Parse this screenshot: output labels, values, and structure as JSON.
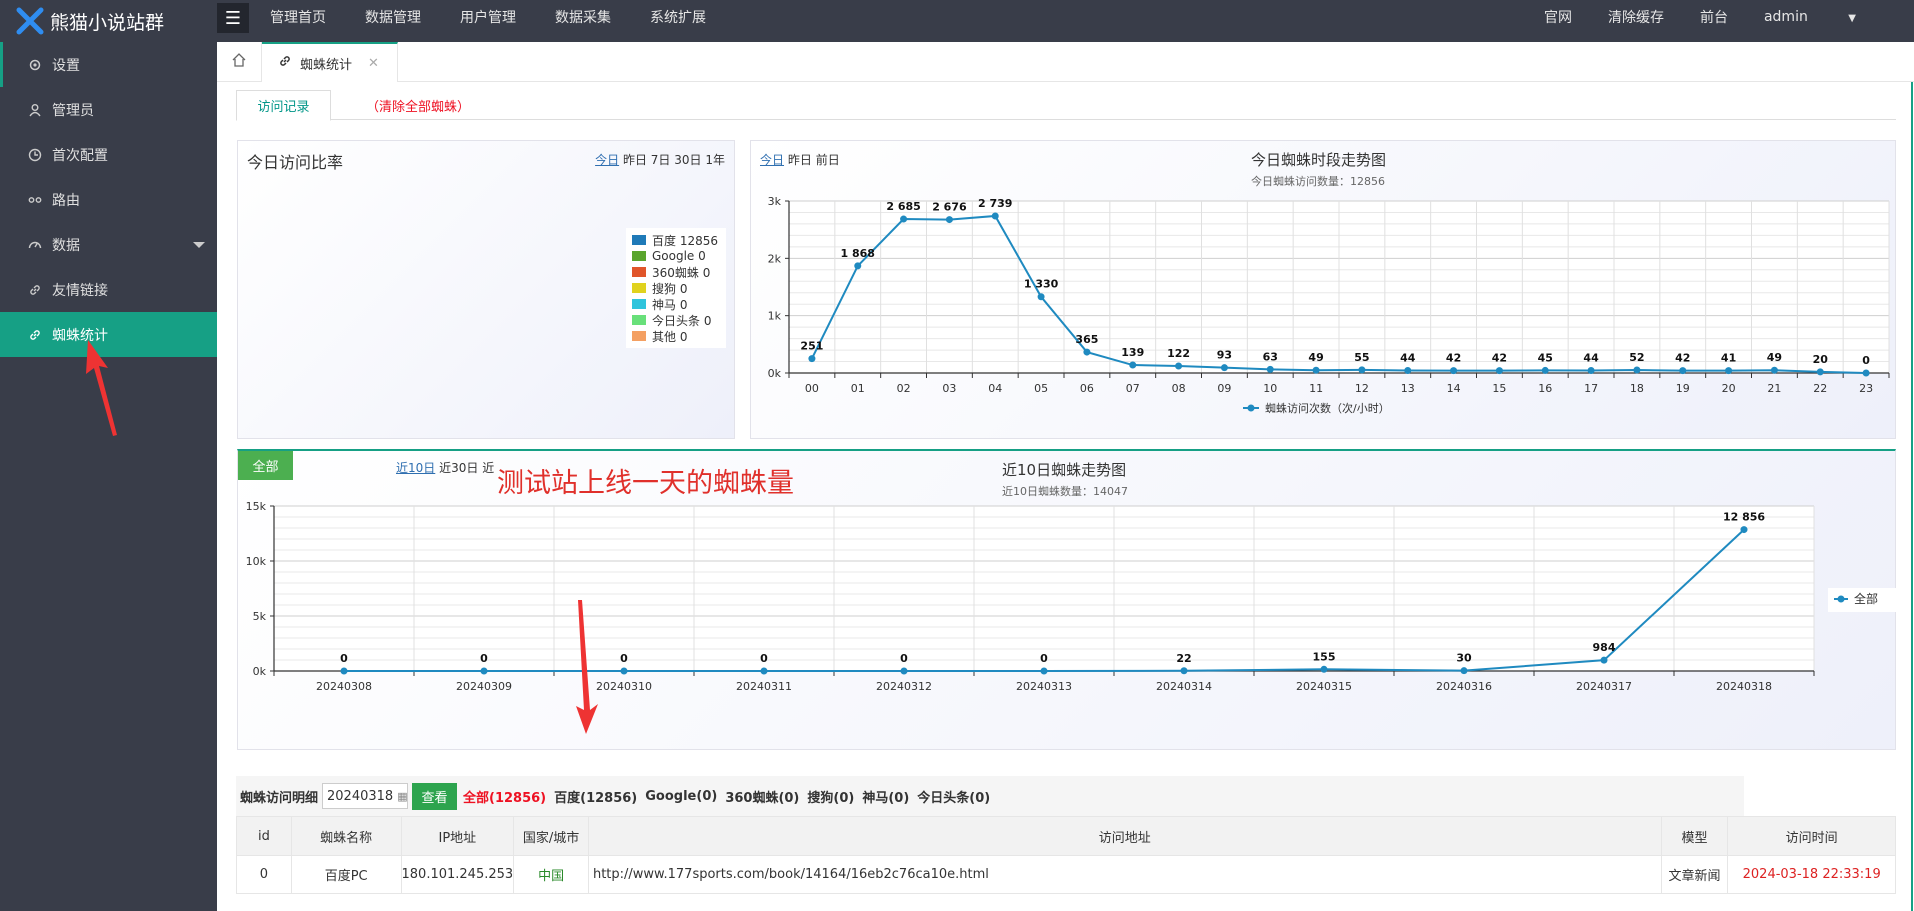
{
  "brand": {
    "name": "熊猫小说站群"
  },
  "topnav": {
    "items": [
      "管理首页",
      "数据管理",
      "用户管理",
      "数据采集",
      "系统扩展"
    ],
    "right": [
      "官网",
      "清除缓存",
      "前台"
    ],
    "user": "admin"
  },
  "sidebar": {
    "items": [
      {
        "label": "设置",
        "icon": "gear-icon"
      },
      {
        "label": "管理员",
        "icon": "user-icon"
      },
      {
        "label": "首次配置",
        "icon": "clock-icon"
      },
      {
        "label": "路由",
        "icon": "route-icon"
      },
      {
        "label": "数据",
        "icon": "dashboard-icon"
      },
      {
        "label": "友情链接",
        "icon": "link-icon"
      },
      {
        "label": "蜘蛛统计",
        "icon": "link-icon"
      }
    ]
  },
  "tabs": {
    "current": "蜘蛛统计"
  },
  "subtabs": {
    "records": "访问记录",
    "clear": "（清除全部蜘蛛）"
  },
  "ratio_panel": {
    "title": "今日访问比率",
    "periods": [
      "今日",
      "昨日",
      "7日",
      "30日",
      "1年"
    ],
    "legend": [
      {
        "label": "百度 12856",
        "color": "#1f7ab8"
      },
      {
        "label": "Google 0",
        "color": "#5aa52d"
      },
      {
        "label": "360蜘蛛 0",
        "color": "#e0552a"
      },
      {
        "label": "搜狗 0",
        "color": "#e0d21e"
      },
      {
        "label": "神马 0",
        "color": "#2fc4dc"
      },
      {
        "label": "今日头条 0",
        "color": "#68e07a"
      },
      {
        "label": "其他 0",
        "color": "#f4a062"
      }
    ]
  },
  "hourly_panel": {
    "periods": [
      "今日",
      "昨日",
      "前日"
    ],
    "title": "今日蜘蛛时段走势图",
    "subtitle": "今日蜘蛛访问数量：12856",
    "legend": "蜘蛛访问次数（次/小时）",
    "chart_data": {
      "type": "line",
      "categories": [
        "00",
        "01",
        "02",
        "03",
        "04",
        "05",
        "06",
        "07",
        "08",
        "09",
        "10",
        "11",
        "12",
        "13",
        "14",
        "15",
        "16",
        "17",
        "18",
        "19",
        "20",
        "21",
        "22",
        "23"
      ],
      "values": [
        251,
        1868,
        2685,
        2676,
        2739,
        1330,
        365,
        139,
        122,
        93,
        63,
        49,
        55,
        44,
        42,
        42,
        45,
        44,
        52,
        42,
        41,
        49,
        20,
        0
      ],
      "labels": [
        "251",
        "1 868",
        "2 685",
        "2 676",
        "2 739",
        "1 330",
        "365",
        "139",
        "122",
        "93",
        "63",
        "49",
        "55",
        "44",
        "42",
        "42",
        "45",
        "44",
        "52",
        "42",
        "41",
        "49",
        "20",
        "0"
      ],
      "yticks": [
        "0k",
        "1k",
        "2k",
        "3k"
      ],
      "ylim": [
        0,
        3000
      ],
      "color": "#1f8ac0"
    }
  },
  "ten_day_panel": {
    "all_label": "全部",
    "periods": [
      "近10日",
      "近30日",
      "近"
    ],
    "note": "测试站上线一天的蜘蛛量",
    "title": "近10日蜘蛛走势图",
    "subtitle": "近10日蜘蛛数量：14047",
    "legend": "全部",
    "chart_data": {
      "type": "line",
      "categories": [
        "20240308",
        "20240309",
        "20240310",
        "20240311",
        "20240312",
        "20240313",
        "20240314",
        "20240315",
        "20240316",
        "20240317",
        "20240318"
      ],
      "values": [
        0,
        0,
        0,
        0,
        0,
        0,
        22,
        155,
        30,
        984,
        12856
      ],
      "labels": [
        "0",
        "0",
        "0",
        "0",
        "0",
        "0",
        "22",
        "155",
        "30",
        "984",
        "12 856"
      ],
      "yticks": [
        "0k",
        "5k",
        "10k",
        "15k"
      ],
      "ylim": [
        0,
        15000
      ],
      "color": "#1f8ac0"
    }
  },
  "detail": {
    "label": "蜘蛛访问明细",
    "date": "20240318",
    "search": "查看",
    "filters": [
      "全部(12856)",
      "百度(12856)",
      "Google(0)",
      "360蜘蛛(0)",
      "搜狗(0)",
      "神马(0)",
      "今日头条(0)"
    ],
    "columns": [
      "id",
      "蜘蛛名称",
      "IP地址",
      "国家/城市",
      "访问地址",
      "模型",
      "访问时间"
    ],
    "rows": [
      [
        "0",
        "百度PC",
        "180.101.245.253",
        "中国",
        "http://www.177sports.com/book/14164/16eb2c76ca10e.html",
        "文章新闻",
        "2024-03-18 22:33:19"
      ]
    ]
  }
}
